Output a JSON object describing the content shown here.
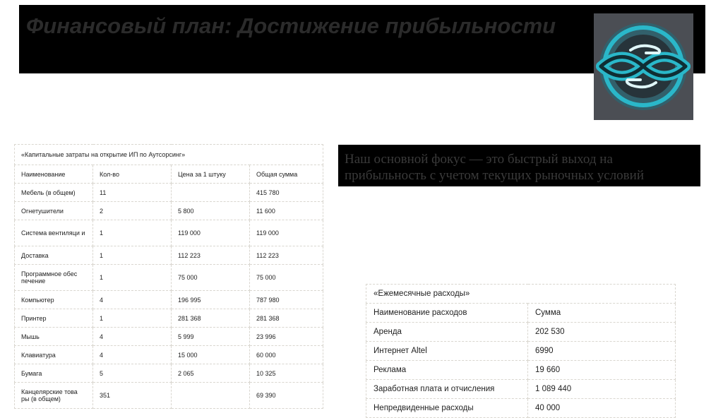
{
  "header": {
    "title": "Финансовый план:  Достижение прибыльности"
  },
  "logo": {
    "icon": "handshake-link-icon",
    "colors": {
      "bg": "#4b4e54",
      "ring": "#2ab7c9",
      "light": "#dff6f8"
    }
  },
  "focus": {
    "text": "Наш основной фокус — это быстрый выход на прибыльность с учетом текущих рыночных условий"
  },
  "capex": {
    "caption": "«Капитальные затраты на открытие ИП по Аутсорсинг»",
    "headers": [
      "Наименование",
      "Кол-во",
      "Цена за 1 штуку",
      "Общая сумма"
    ],
    "rows": [
      [
        "Мебель (в общем)",
        "11",
        "",
        "415 780"
      ],
      [
        "Огнетушители",
        "2",
        "5 800",
        "11 600"
      ],
      [
        "Система вентиляци и",
        "1",
        "119 000",
        "119 000"
      ],
      [
        "Доставка",
        "1",
        "112 223",
        "112 223"
      ],
      [
        "Программное обес печение",
        "1",
        "75 000",
        "75 000"
      ],
      [
        "Компьютер",
        "4",
        "196 995",
        "787 980"
      ],
      [
        "Принтер",
        "1",
        "281 368",
        "281 368"
      ],
      [
        "Мышь",
        "4",
        "5 999",
        "23 996"
      ],
      [
        "Клавиатура",
        "4",
        "15 000",
        "60 000"
      ],
      [
        "Бумага",
        "5",
        "2 065",
        "10 325"
      ],
      [
        "Канцелярские това ры (в общем)",
        "351",
        "",
        "69 390"
      ]
    ]
  },
  "monthly": {
    "caption": "«Ежемесячные расходы»",
    "headers": [
      "Наименование расходов",
      "Сумма"
    ],
    "rows": [
      [
        "Аренда",
        "202 530"
      ],
      [
        "Интернет Altel",
        "6990"
      ],
      [
        "Реклама",
        "19 660"
      ],
      [
        "Заработная плата и отчисления",
        "1 089 440"
      ],
      [
        "Непредвиденные расходы",
        "40 000"
      ]
    ]
  }
}
